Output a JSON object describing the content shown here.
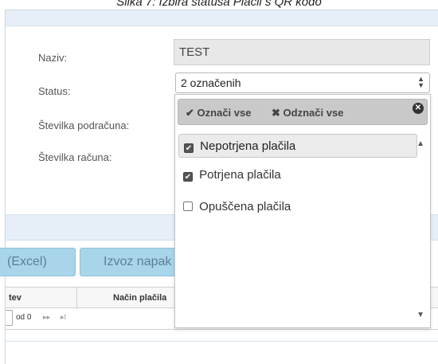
{
  "caption": "Slika 7: Izbira statusa Plačil s QR kodo",
  "form": {
    "name_label": "Naziv:",
    "name_value": "TEST",
    "status_label": "Status:",
    "status_value": "2 označenih",
    "account_label": "Številka podračuna:",
    "invoice_label": "Številka računa:"
  },
  "dropdown": {
    "select_all": "Označi vse",
    "deselect_all": "Odznači vse",
    "options": [
      {
        "label": "Nepotrjena plačila",
        "checked": true
      },
      {
        "label": "Potrjena plačila",
        "checked": true
      },
      {
        "label": "Opuščena plačila",
        "checked": false
      }
    ]
  },
  "buttons": {
    "excel": "(Excel)",
    "errors": "Izvoz napak"
  },
  "table": {
    "col1_fragment": "tev",
    "col2": "Način plačila"
  },
  "pager": {
    "of_text": "od 0",
    "next": "▸▸",
    "last": "▸I"
  },
  "icons": {
    "check": "✔",
    "cross": "✖",
    "close": "✕",
    "up": "▲",
    "down": "▼"
  }
}
